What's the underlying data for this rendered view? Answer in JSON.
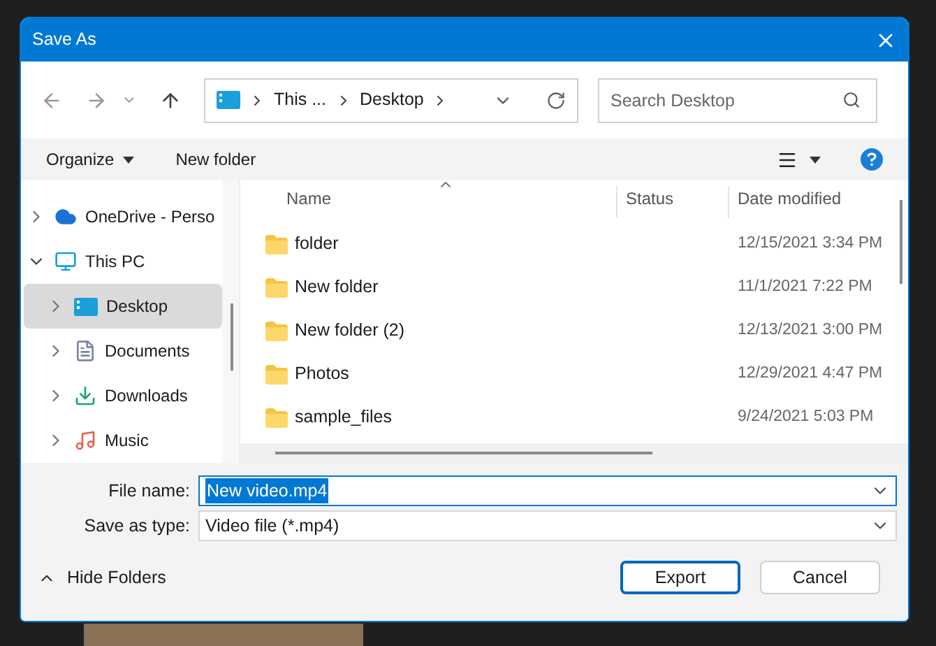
{
  "window": {
    "title": "Save As"
  },
  "address_bar": {
    "segments": [
      "This ...",
      "Desktop"
    ]
  },
  "search": {
    "placeholder": "Search Desktop"
  },
  "toolbar": {
    "organize": "Organize",
    "new_folder": "New folder"
  },
  "sidebar": {
    "items": [
      {
        "label": "OneDrive - Perso",
        "kind": "cloud",
        "expanded": false,
        "selected": false
      },
      {
        "label": "This PC",
        "kind": "pc",
        "expanded": true,
        "selected": false,
        "children": [
          {
            "label": "Desktop",
            "kind": "desktop",
            "expanded": false,
            "selected": true
          },
          {
            "label": "Documents",
            "kind": "documents",
            "expanded": false,
            "selected": false
          },
          {
            "label": "Downloads",
            "kind": "downloads",
            "expanded": false,
            "selected": false
          },
          {
            "label": "Music",
            "kind": "music",
            "expanded": false,
            "selected": false
          }
        ]
      }
    ]
  },
  "table": {
    "columns": [
      "Name",
      "Status",
      "Date modified"
    ],
    "rows": [
      {
        "name": "folder",
        "date": "12/15/2021 3:34 PM"
      },
      {
        "name": "New folder",
        "date": "11/1/2021 7:22 PM"
      },
      {
        "name": "New folder (2)",
        "date": "12/13/2021 3:00 PM"
      },
      {
        "name": "Photos",
        "date": "12/29/2021 4:47 PM"
      },
      {
        "name": "sample_files",
        "date": "9/24/2021 5:03 PM"
      }
    ]
  },
  "form": {
    "file_name_label": "File name:",
    "file_name": "New video.mp4",
    "type_label": "Save as type:",
    "type": "Video file (*.mp4)"
  },
  "footer": {
    "hide_folders": "Hide Folders",
    "buttons": [
      {
        "label": "Export",
        "default": true
      },
      {
        "label": "Cancel",
        "default": false
      }
    ]
  }
}
